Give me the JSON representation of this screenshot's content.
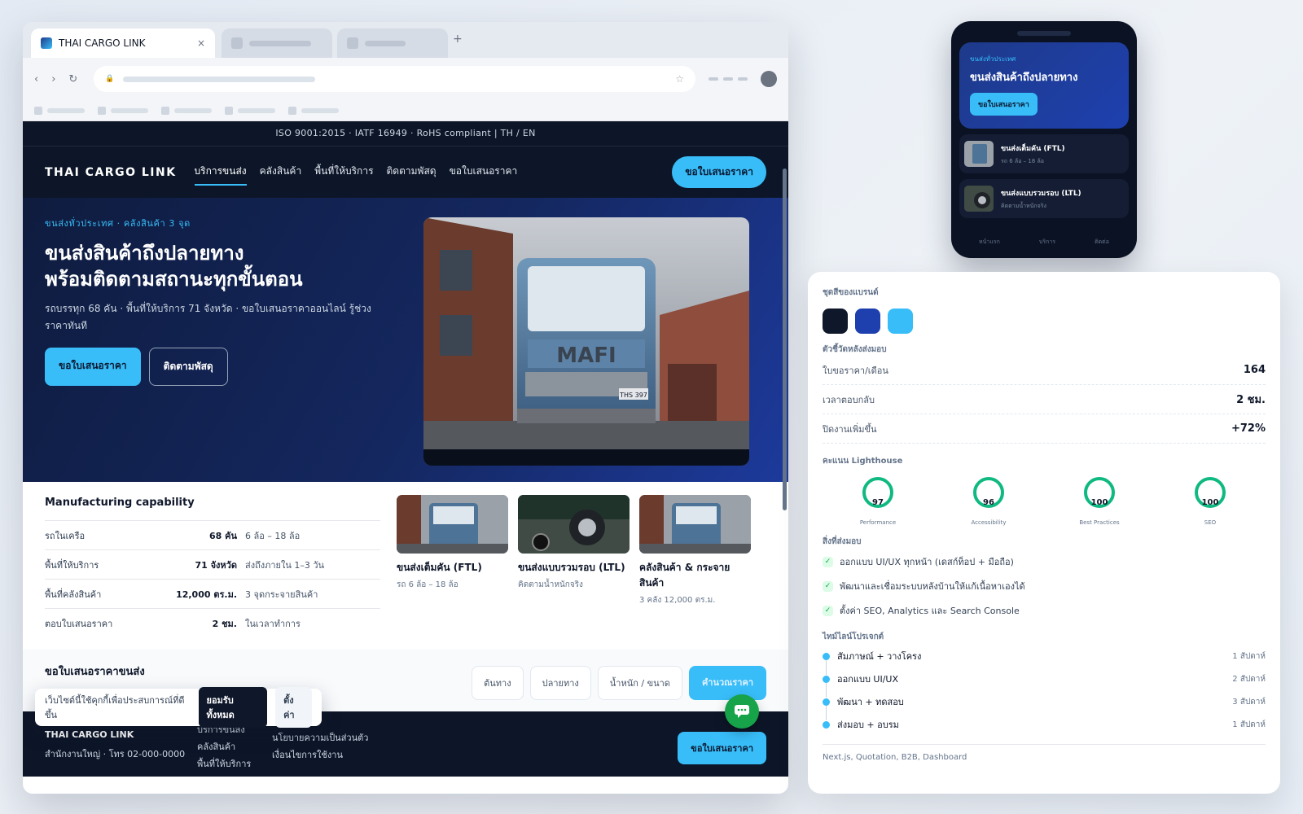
{
  "browser": {
    "tab_title": "THAI CARGO LINK",
    "tab_close": "×",
    "new_tab": "+",
    "nav_back": "‹",
    "nav_forward": "›",
    "nav_reload": "↻",
    "lock": "🔒",
    "star": "☆"
  },
  "site": {
    "certifications": "ISO 9001:2015 · IATF 16949 · RoHS compliant  |  TH / EN",
    "logo": "THAI CARGO LINK",
    "nav": [
      "บริการขนส่ง",
      "คลังสินค้า",
      "พื้นที่ให้บริการ",
      "ติดตามพัสดุ",
      "ขอใบเสนอราคา"
    ],
    "nav_cta": "ขอใบเสนอราคา",
    "hero": {
      "eyebrow": "ขนส่งทั่วประเทศ · คลังสินค้า 3 จุด",
      "title_line1": "ขนส่งสินค้าถึงปลายทาง",
      "title_line2": "พร้อมติดตามสถานะทุกขั้นตอน",
      "subtitle": "รถบรรทุก 68 คัน · พื้นที่ให้บริการ 71 จังหวัด · ขอใบเสนอราคาออนไลน์ รู้ช่วงราคาทันที",
      "primary_cta": "ขอใบเสนอราคา",
      "secondary_cta": "ติดตามพัสดุ",
      "truck_brand": "MAFI",
      "plate": "THS 397"
    },
    "capability": {
      "title": "Manufacturing capability",
      "rows": [
        {
          "label": "รถในเครือ",
          "value": "68 คัน",
          "note": "6 ล้อ – 18 ล้อ"
        },
        {
          "label": "พื้นที่ให้บริการ",
          "value": "71 จังหวัด",
          "note": "ส่งถึงภายใน 1–3 วัน"
        },
        {
          "label": "พื้นที่คลังสินค้า",
          "value": "12,000 ตร.ม.",
          "note": "3 จุดกระจายสินค้า"
        },
        {
          "label": "ตอบใบเสนอราคา",
          "value": "2 ชม.",
          "note": "ในเวลาทำการ"
        }
      ]
    },
    "services": [
      {
        "title": "ขนส่งเต็มคัน (FTL)",
        "sub": "รถ 6 ล้อ – 18 ล้อ"
      },
      {
        "title": "ขนส่งแบบรวมรอบ (LTL)",
        "sub": "คิดตามน้ำหนักจริง"
      },
      {
        "title": "คลังสินค้า & กระจายสินค้า",
        "sub": "3 คลัง 12,000 ตร.ม."
      }
    ],
    "quote": {
      "title": "ขอใบเสนอราคาขนส่ง",
      "origin": "ต้นทาง",
      "destination": "ปลายทาง",
      "weight": "น้ำหนัก / ขนาด",
      "submit": "คำนวณราคา"
    },
    "footer": {
      "name": "THAI CARGO LINK",
      "address": "สำนักงานใหญ่ · โทร 02-000-0000",
      "col1": [
        "บริการขนส่ง",
        "คลังสินค้า",
        "พื้นที่ให้บริการ"
      ],
      "col2": [
        "นโยบายความเป็นส่วนตัว",
        "เงื่อนไขการใช้งาน"
      ],
      "cta": "ขอใบเสนอราคา"
    },
    "cookie": {
      "text": "เว็บไซต์นี้ใช้คุกกี้เพื่อประสบการณ์ที่ดีขึ้น",
      "accept": "ยอมรับทั้งหมด",
      "settings": "ตั้งค่า"
    }
  },
  "phone": {
    "eyebrow": "ขนส่งทั่วประเทศ",
    "title": "ขนส่งสินค้าถึงปลายทาง",
    "cta": "ขอใบเสนอราคา",
    "items": [
      {
        "title": "ขนส่งเต็มคัน (FTL)",
        "sub": "รถ 6 ล้อ – 18 ล้อ"
      },
      {
        "title": "ขนส่งแบบรวมรอบ (LTL)",
        "sub": "คิดตามน้ำหนักจริง"
      }
    ],
    "tabs": [
      "หน้าแรก",
      "บริการ",
      "ติดต่อ"
    ]
  },
  "panel": {
    "brand_title": "ชุดสีของแบรนด์",
    "brand_colors": [
      "#0f172a",
      "#1e40af",
      "#38bdf8"
    ],
    "kpi_title": "ตัวชี้วัดหลังส่งมอบ",
    "kpis": [
      {
        "label": "ใบขอราคา/เดือน",
        "value": "164"
      },
      {
        "label": "เวลาตอบกลับ",
        "value": "2 ชม."
      },
      {
        "label": "ปิดงานเพิ่มขึ้น",
        "value": "+72%"
      }
    ],
    "lighthouse_title": "คะแนน Lighthouse",
    "lighthouse": [
      {
        "label": "Performance",
        "score": "97"
      },
      {
        "label": "Accessibility",
        "score": "96"
      },
      {
        "label": "Best Practices",
        "score": "100"
      },
      {
        "label": "SEO",
        "score": "100"
      }
    ],
    "deliverables_title": "สิ่งที่ส่งมอบ",
    "deliverables": [
      "ออกแบบ UI/UX ทุกหน้า (เดสก์ท็อป + มือถือ)",
      "พัฒนาและเชื่อมระบบหลังบ้านให้แก้เนื้อหาเองได้",
      "ตั้งค่า SEO, Analytics และ Search Console"
    ],
    "timeline_title": "ไทม์ไลน์โปรเจกต์",
    "timeline": [
      {
        "label": "สัมภาษณ์ + วางโครง",
        "duration": "1 สัปดาห์"
      },
      {
        "label": "ออกแบบ UI/UX",
        "duration": "2 สัปดาห์"
      },
      {
        "label": "พัฒนา + ทดสอบ",
        "duration": "3 สัปดาห์"
      },
      {
        "label": "ส่งมอบ + อบรม",
        "duration": "1 สัปดาห์"
      }
    ],
    "stack": "Next.js, Quotation, B2B, Dashboard"
  }
}
